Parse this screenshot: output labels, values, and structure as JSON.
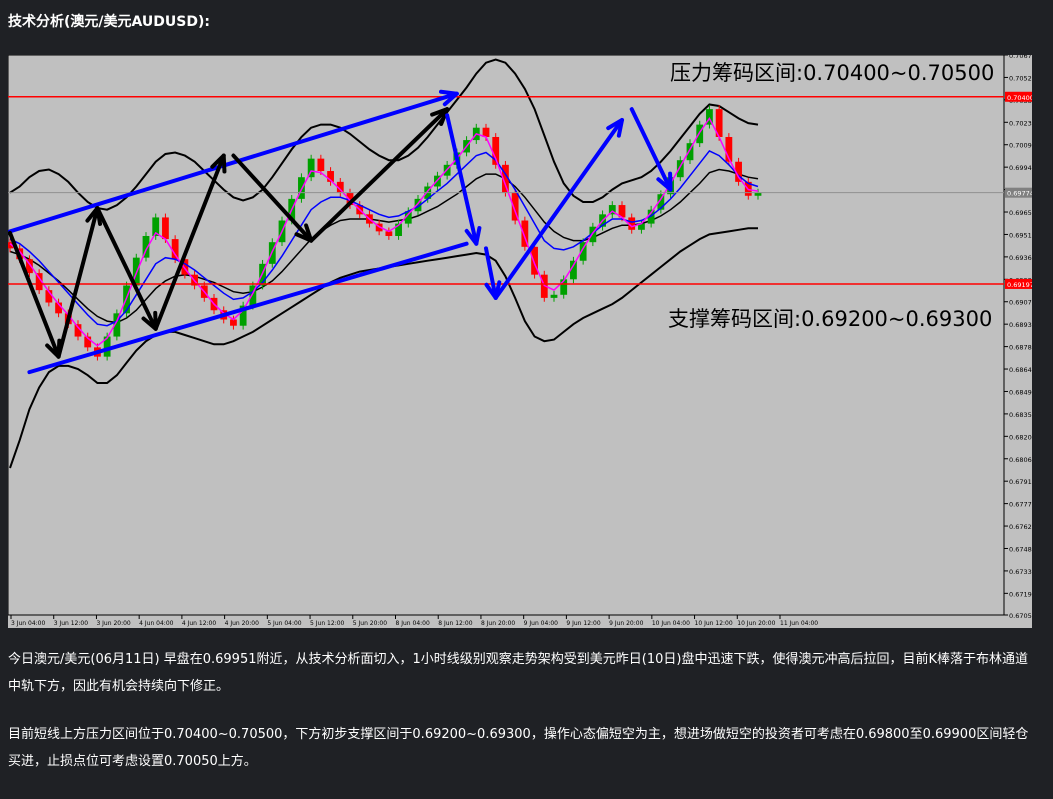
{
  "page": {
    "heading": "技术分析(澳元/美元AUDUSD):",
    "paragraph_1": "今日澳元/美元(06月11日) 早盘在0.69951附近，从技术分析面切入，1小时线级别观察走势架构受到美元昨日(10日)盘中迅速下跌，使得澳元冲高后拉回，目前K棒落于布林通道中轨下方，因此有机会持续向下修正。",
    "paragraph_2": "目前短线上方压力区间位于0.70400~0.70500，下方初步支撑区间于0.69200~0.69300，操作心态偏短空为主，想进场做短空的投资者可考虑在0.69800至0.69900区间轻仓买进，止损点位可考虑设置0.70050上方。"
  },
  "chart_data": {
    "type": "candlestick",
    "symbol": "AUDUSD",
    "timeframe": "H1",
    "y_ticks": [
      "0.70670",
      "0.70525",
      "0.70380",
      "0.70235",
      "0.70090",
      "0.69945",
      "0.69800",
      "0.69655",
      "0.69510",
      "0.69365",
      "0.69220",
      "0.69075",
      "0.68930",
      "0.68785",
      "0.68640",
      "0.68495",
      "0.68350",
      "0.68205",
      "0.68060",
      "0.67915",
      "0.67770",
      "0.67625",
      "0.67480",
      "0.67335",
      "0.67190",
      "0.67050"
    ],
    "ylim": [
      0.6705,
      0.7067
    ],
    "x_ticks": [
      "3 Jun 04:00",
      "3 Jun 12:00",
      "3 Jun 20:00",
      "4 Jun 04:00",
      "4 Jun 12:00",
      "4 Jun 20:00",
      "5 Jun 04:00",
      "5 Jun 12:00",
      "5 Jun 20:00",
      "8 Jun 04:00",
      "8 Jun 12:00",
      "8 Jun 20:00",
      "9 Jun 04:00",
      "9 Jun 12:00",
      "9 Jun 20:00",
      "10 Jun 04:00",
      "10 Jun 12:00",
      "10 Jun 20:00",
      "11 Jun 04:00"
    ],
    "price_labels": [
      {
        "value": 0.704,
        "text": "0.70400",
        "color": "#ff0000"
      },
      {
        "value": 0.6919,
        "text": "0.69197",
        "color": "#ff0000"
      },
      {
        "value": 0.6978,
        "text": "0.69774",
        "color": "#808080"
      }
    ],
    "resistance_line": 0.704,
    "support_line": 0.6919,
    "current_price": 0.6978,
    "annotations": {
      "resistance": "压力筹码区间:0.70400~0.70500",
      "support": "支撑筹码区间:0.69200~0.69300"
    },
    "series": [
      {
        "type": "close",
        "values": [
          0.6942,
          0.6935,
          0.6926,
          0.6915,
          0.6907,
          0.69,
          0.6893,
          0.6885,
          0.6878,
          0.6872,
          0.6885,
          0.69,
          0.6918,
          0.6936,
          0.695,
          0.6962,
          0.6948,
          0.6935,
          0.6925,
          0.6918,
          0.691,
          0.6902,
          0.6896,
          0.6892,
          0.6905,
          0.6918,
          0.6932,
          0.6946,
          0.696,
          0.6974,
          0.6988,
          0.7,
          0.6992,
          0.6985,
          0.6978,
          0.697,
          0.6964,
          0.6958,
          0.6953,
          0.695,
          0.6958,
          0.6966,
          0.6974,
          0.6982,
          0.6989,
          0.6996,
          0.7004,
          0.7012,
          0.702,
          0.7014,
          0.6996,
          0.6978,
          0.696,
          0.6943,
          0.6925,
          0.691,
          0.6912,
          0.6922,
          0.6934,
          0.6946,
          0.6956,
          0.6964,
          0.697,
          0.6962,
          0.6954,
          0.6958,
          0.6967,
          0.6977,
          0.6988,
          0.6999,
          0.701,
          0.7022,
          0.7032,
          0.7014,
          0.6998,
          0.6985,
          0.6976,
          0.6978
        ]
      },
      {
        "type": "ma_fast",
        "color": "#ff00ff",
        "values": [
          0.6945,
          0.694,
          0.6932,
          0.6923,
          0.6914,
          0.6906,
          0.6899,
          0.6891,
          0.6884,
          0.6879,
          0.6884,
          0.6895,
          0.691,
          0.6926,
          0.6941,
          0.6952,
          0.6948,
          0.6938,
          0.6929,
          0.6921,
          0.6914,
          0.6906,
          0.69,
          0.6896,
          0.6902,
          0.6913,
          0.6926,
          0.694,
          0.6953,
          0.6967,
          0.698,
          0.6992,
          0.6991,
          0.6986,
          0.698,
          0.6973,
          0.6967,
          0.6961,
          0.6956,
          0.6953,
          0.6957,
          0.6964,
          0.6971,
          0.6979,
          0.6986,
          0.6993,
          0.7,
          0.7008,
          0.7016,
          0.7014,
          0.7,
          0.6983,
          0.6966,
          0.6949,
          0.6932,
          0.6918,
          0.6915,
          0.6921,
          0.6931,
          0.6942,
          0.6952,
          0.696,
          0.6966,
          0.6962,
          0.6956,
          0.6958,
          0.6965,
          0.6974,
          0.6984,
          0.6995,
          0.7006,
          0.7017,
          0.7026,
          0.7014,
          0.7,
          0.6988,
          0.698,
          0.6979
        ]
      },
      {
        "type": "ma_slow",
        "color": "#0000ff",
        "values": [
          0.6948,
          0.6945,
          0.694,
          0.6934,
          0.6927,
          0.692,
          0.6913,
          0.6906,
          0.6899,
          0.6893,
          0.6892,
          0.6895,
          0.6902,
          0.6912,
          0.6922,
          0.6932,
          0.6936,
          0.6935,
          0.6932,
          0.6928,
          0.6923,
          0.6918,
          0.6913,
          0.6909,
          0.691,
          0.6914,
          0.692,
          0.6928,
          0.6937,
          0.6947,
          0.6957,
          0.6967,
          0.6972,
          0.6975,
          0.6975,
          0.6973,
          0.697,
          0.6967,
          0.6964,
          0.6962,
          0.6963,
          0.6966,
          0.6969,
          0.6974,
          0.6979,
          0.6984,
          0.699,
          0.6996,
          0.7002,
          0.7004,
          0.6999,
          0.699,
          0.698,
          0.6969,
          0.6958,
          0.6947,
          0.6942,
          0.6941,
          0.6943,
          0.6947,
          0.6952,
          0.6957,
          0.6961,
          0.6961,
          0.6959,
          0.696,
          0.6963,
          0.6968,
          0.6974,
          0.6981,
          0.6989,
          0.6997,
          0.7005,
          0.7002,
          0.6996,
          0.6989,
          0.6984,
          0.6982
        ]
      },
      {
        "type": "bb_mid",
        "color": "#000000",
        "values": [
          0.694,
          0.6938,
          0.6935,
          0.6931,
          0.6926,
          0.6921,
          0.6915,
          0.6909,
          0.6903,
          0.6898,
          0.6895,
          0.6894,
          0.6897,
          0.6902,
          0.6909,
          0.6916,
          0.6921,
          0.6924,
          0.6925,
          0.6924,
          0.6922,
          0.692,
          0.6917,
          0.6914,
          0.6913,
          0.6914,
          0.6917,
          0.6921,
          0.6927,
          0.6934,
          0.6941,
          0.6948,
          0.6953,
          0.6957,
          0.696,
          0.6961,
          0.6961,
          0.6961,
          0.696,
          0.6959,
          0.696,
          0.6961,
          0.6963,
          0.6966,
          0.6969,
          0.6973,
          0.6977,
          0.6982,
          0.6987,
          0.699,
          0.699,
          0.6987,
          0.6982,
          0.6975,
          0.6967,
          0.6959,
          0.6953,
          0.6949,
          0.6947,
          0.6947,
          0.6949,
          0.6952,
          0.6955,
          0.6957,
          0.6957,
          0.6958,
          0.696,
          0.6963,
          0.6967,
          0.6972,
          0.6978,
          0.6984,
          0.6991,
          0.6993,
          0.6992,
          0.699,
          0.6988,
          0.6987
        ]
      },
      {
        "type": "bb_upper",
        "color": "#000000",
        "values": [
          0.6978,
          0.6982,
          0.6988,
          0.6992,
          0.6993,
          0.699,
          0.6985,
          0.6978,
          0.6972,
          0.6968,
          0.6967,
          0.697,
          0.6975,
          0.6982,
          0.699,
          0.6998,
          0.7003,
          0.7004,
          0.7002,
          0.6998,
          0.6992,
          0.6986,
          0.698,
          0.6975,
          0.6973,
          0.6975,
          0.698,
          0.6988,
          0.6997,
          0.7006,
          0.7014,
          0.702,
          0.7022,
          0.7022,
          0.702,
          0.7016,
          0.7011,
          0.7006,
          0.7002,
          0.6999,
          0.6999,
          0.7002,
          0.7007,
          0.7014,
          0.7022,
          0.703,
          0.7038,
          0.7046,
          0.7055,
          0.7062,
          0.7064,
          0.7062,
          0.7055,
          0.7045,
          0.7032,
          0.7015,
          0.6998,
          0.6984,
          0.6976,
          0.6972,
          0.6972,
          0.6975,
          0.698,
          0.6984,
          0.6986,
          0.6988,
          0.6992,
          0.6998,
          0.7005,
          0.7013,
          0.7021,
          0.7029,
          0.7035,
          0.7034,
          0.703,
          0.7026,
          0.7023,
          0.7022
        ]
      },
      {
        "type": "bb_lower",
        "color": "#000000",
        "values": [
          0.68,
          0.6818,
          0.6838,
          0.6852,
          0.6862,
          0.6866,
          0.6866,
          0.6864,
          0.686,
          0.6855,
          0.6855,
          0.686,
          0.6868,
          0.6876,
          0.6882,
          0.6886,
          0.6888,
          0.6888,
          0.6886,
          0.6884,
          0.6882,
          0.688,
          0.688,
          0.6882,
          0.6885,
          0.6888,
          0.6892,
          0.6896,
          0.69,
          0.6904,
          0.6908,
          0.6912,
          0.6916,
          0.692,
          0.6923,
          0.6925,
          0.6927,
          0.6928,
          0.6929,
          0.693,
          0.6931,
          0.6932,
          0.6933,
          0.6934,
          0.6935,
          0.6936,
          0.6937,
          0.6938,
          0.6939,
          0.6938,
          0.6934,
          0.6924,
          0.691,
          0.6895,
          0.6885,
          0.6882,
          0.6883,
          0.6888,
          0.6893,
          0.6897,
          0.69,
          0.6903,
          0.6906,
          0.691,
          0.6915,
          0.692,
          0.6925,
          0.693,
          0.6935,
          0.694,
          0.6944,
          0.6948,
          0.6951,
          0.6952,
          0.6953,
          0.6954,
          0.6955,
          0.6955
        ]
      }
    ],
    "trend_lines": [
      {
        "color": "#0000ff",
        "from": {
          "x": 0,
          "y": 0.6953
        },
        "to": {
          "x": 46,
          "y": 0.7042
        },
        "arrow": true
      },
      {
        "color": "#0000ff",
        "from": {
          "x": 2,
          "y": 0.6862
        },
        "to": {
          "x": 47,
          "y": 0.6945
        },
        "arrow": false
      },
      {
        "color": "#000000",
        "from": {
          "x": 0,
          "y": 0.6952
        },
        "to": {
          "x": 5,
          "y": 0.6872
        },
        "arrow": true
      },
      {
        "color": "#000000",
        "from": {
          "x": 5,
          "y": 0.6872
        },
        "to": {
          "x": 9,
          "y": 0.6968
        },
        "arrow": true
      },
      {
        "color": "#000000",
        "from": {
          "x": 9,
          "y": 0.6968
        },
        "to": {
          "x": 15,
          "y": 0.689
        },
        "arrow": true
      },
      {
        "color": "#000000",
        "from": {
          "x": 15,
          "y": 0.689
        },
        "to": {
          "x": 22,
          "y": 0.7002
        },
        "arrow": true
      },
      {
        "color": "#000000",
        "from": {
          "x": 23,
          "y": 0.7002
        },
        "to": {
          "x": 31,
          "y": 0.6947
        },
        "arrow": true
      },
      {
        "color": "#000000",
        "from": {
          "x": 31,
          "y": 0.6947
        },
        "to": {
          "x": 45,
          "y": 0.7032
        },
        "arrow": true
      },
      {
        "color": "#0000ff",
        "from": {
          "x": 45,
          "y": 0.7028
        },
        "to": {
          "x": 48,
          "y": 0.6945
        },
        "arrow": true
      },
      {
        "color": "#0000ff",
        "from": {
          "x": 49,
          "y": 0.6942
        },
        "to": {
          "x": 50,
          "y": 0.691
        },
        "arrow": true
      },
      {
        "color": "#0000ff",
        "from": {
          "x": 50,
          "y": 0.691
        },
        "to": {
          "x": 63,
          "y": 0.7025
        },
        "arrow": true
      },
      {
        "color": "#0000ff",
        "from": {
          "x": 64,
          "y": 0.7032
        },
        "to": {
          "x": 68,
          "y": 0.698
        },
        "arrow": true
      }
    ]
  }
}
